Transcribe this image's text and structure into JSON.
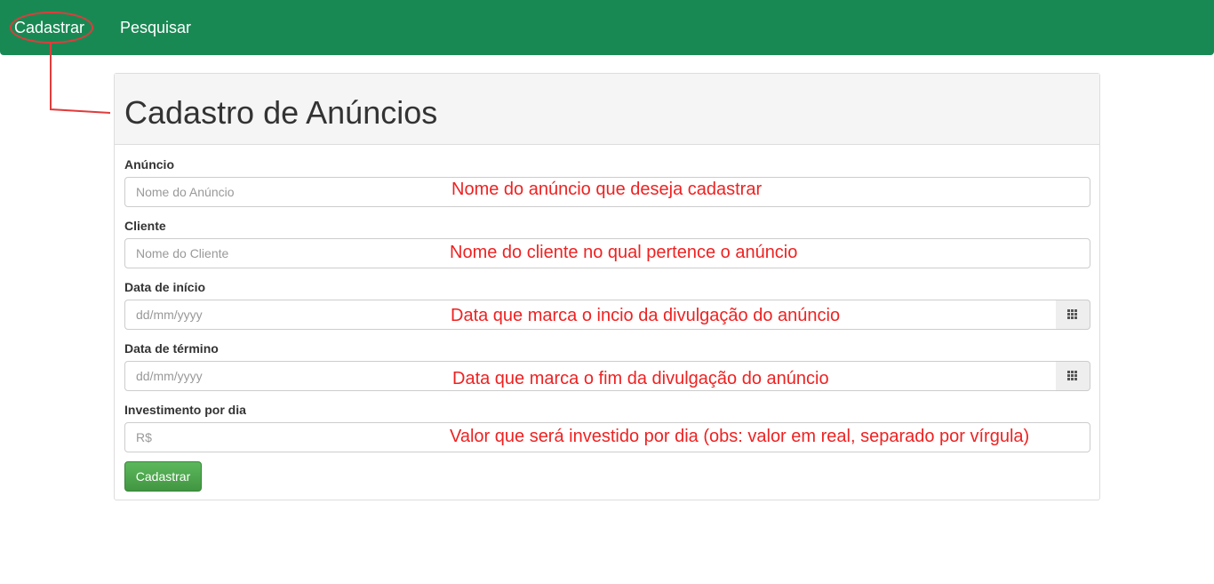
{
  "navbar": {
    "items": [
      {
        "label": "Cadastrar"
      },
      {
        "label": "Pesquisar"
      }
    ],
    "background_color": "#198954"
  },
  "panel": {
    "title": "Cadastro de Anúncios"
  },
  "form": {
    "fields": [
      {
        "label": "Anúncio",
        "placeholder": "Nome do Anúncio",
        "value": ""
      },
      {
        "label": "Cliente",
        "placeholder": "Nome do Cliente",
        "value": ""
      },
      {
        "label": "Data de início",
        "placeholder": "dd/mm/yyyy",
        "value": "",
        "addon_icon": "calendar-grid-icon"
      },
      {
        "label": "Data de término",
        "placeholder": "dd/mm/yyyy",
        "value": "",
        "addon_icon": "calendar-grid-icon"
      },
      {
        "label": "Investimento por dia",
        "placeholder": "R$",
        "value": ""
      }
    ],
    "submit_label": "Cadastrar",
    "submit_color": "#5cb85c"
  },
  "annotations": {
    "color": "#ee2222",
    "notes": [
      "Nome do anúncio que deseja cadastrar",
      "Nome do cliente no qual pertence o anúncio",
      "Data que marca o incio da divulgação do anúncio",
      "Data que marca o fim da divulgação do anúncio",
      "Valor que será investido por dia (obs: valor em real, separado por vírgula)"
    ]
  }
}
